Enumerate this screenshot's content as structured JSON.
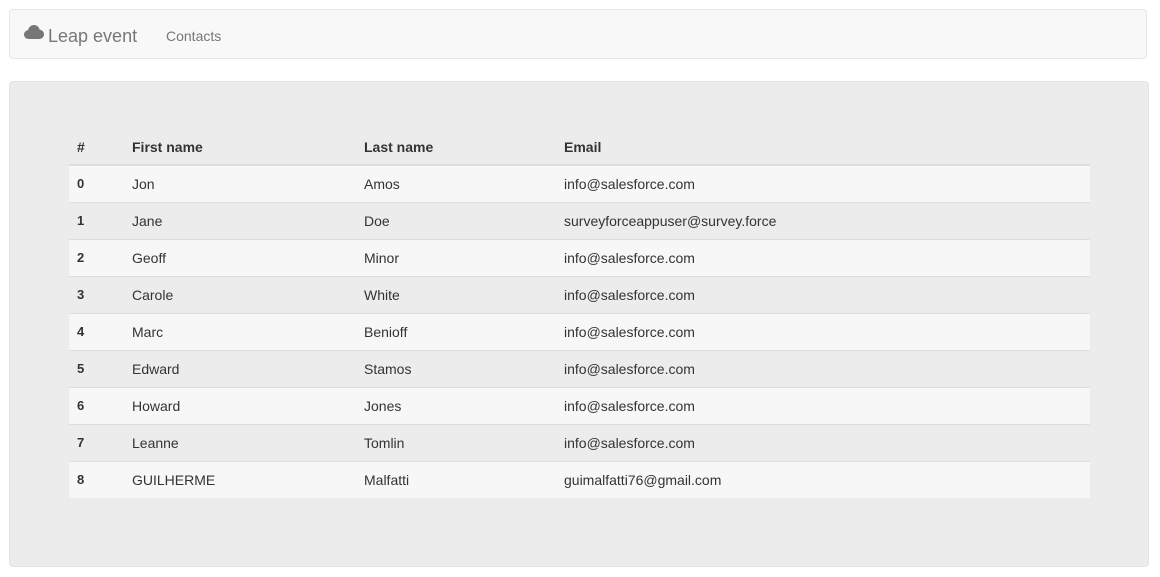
{
  "navbar": {
    "brand_icon": "cloud-icon",
    "brand_label": "Leap event",
    "links": [
      "Contacts"
    ]
  },
  "table": {
    "headers": [
      "#",
      "First name",
      "Last name",
      "Email"
    ],
    "rows": [
      [
        "0",
        "Jon",
        "Amos",
        "info@salesforce.com"
      ],
      [
        "1",
        "Jane",
        "Doe",
        "surveyforceappuser@survey.force"
      ],
      [
        "2",
        "Geoff",
        "Minor",
        "info@salesforce.com"
      ],
      [
        "3",
        "Carole",
        "White",
        "info@salesforce.com"
      ],
      [
        "4",
        "Marc",
        "Benioff",
        "info@salesforce.com"
      ],
      [
        "5",
        "Edward",
        "Stamos",
        "info@salesforce.com"
      ],
      [
        "6",
        "Howard",
        "Jones",
        "info@salesforce.com"
      ],
      [
        "7",
        "Leanne",
        "Tomlin",
        "info@salesforce.com"
      ],
      [
        "8",
        "GUILHERME",
        "Malfatti",
        "guimalfatti76@gmail.com"
      ]
    ]
  }
}
